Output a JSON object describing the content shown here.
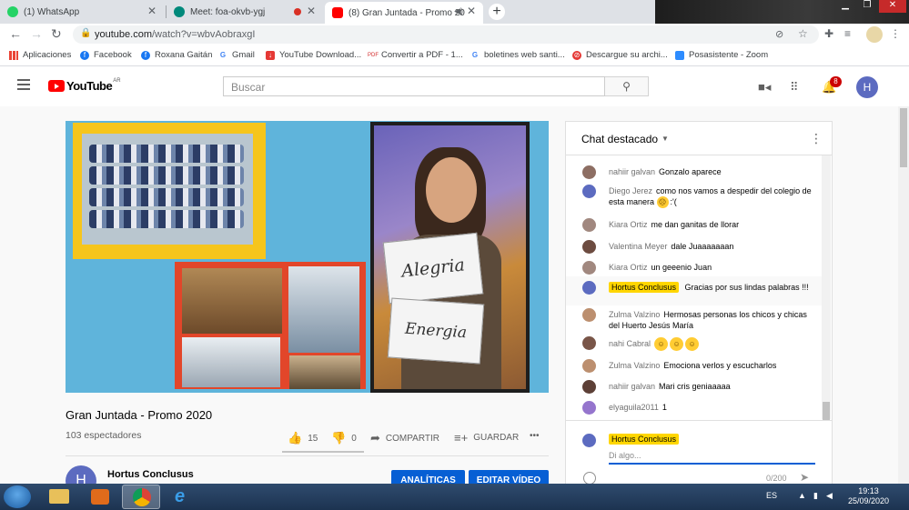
{
  "browser": {
    "tabs": [
      {
        "label": "(1) WhatsApp",
        "icon": "whatsapp-icon",
        "color": "#25d366"
      },
      {
        "label": "Meet: foa-okvb-ygj",
        "icon": "meet-icon",
        "color": "#00897b"
      },
      {
        "label": "(8) Gran Juntada - Promo 20",
        "icon": "youtube-icon",
        "color": "#ff0000"
      }
    ],
    "url_host": "youtube.com",
    "url_path": "/watch?v=wbvAobraxgI",
    "bookmarks": [
      "Aplicaciones",
      "Facebook",
      "Roxana Gaitán",
      "Gmail",
      "YouTube Download...",
      "Convertir a PDF - 1...",
      "boletines web santi...",
      "Descargue su archi...",
      "Posasistente - Zoom"
    ]
  },
  "youtube": {
    "logo_region": "AR",
    "logo_text": "YouTube",
    "search_placeholder": "Buscar",
    "notification_count": "8",
    "user_initial": "H"
  },
  "video": {
    "sign_top": "Alegria",
    "sign_bottom": "Energia",
    "title": "Gran Juntada - Promo 2020",
    "views": "103 espectadores",
    "likes": "15",
    "dislikes": "0",
    "share_label": "COMPARTIR",
    "save_label": "GUARDAR",
    "more_label": "•••"
  },
  "channel": {
    "initial": "H",
    "name": "Hortus Conclusus",
    "analytics_label": "ANALÍTICAS",
    "edit_label": "EDITAR VÍDEO"
  },
  "chat": {
    "title": "Chat destacado",
    "messages": [
      {
        "author": "nahiir galvan",
        "text": "Gonzalo aparece",
        "owner": false
      },
      {
        "author": "Diego Jerez",
        "text": "como nos vamos a despedir del colegio de esta manera",
        "suffix": ":'(",
        "owner": false
      },
      {
        "author": "Kiara Ortiz",
        "text": "me dan ganitas de llorar",
        "owner": false
      },
      {
        "author": "Valentina Meyer",
        "text": "dale Juaaaaaaan",
        "owner": false
      },
      {
        "author": "Kiara Ortiz",
        "text": "un geeenio Juan",
        "owner": false
      },
      {
        "author": "Hortus Conclusus",
        "text": "Gracias por sus lindas palabras !!!",
        "owner": true
      },
      {
        "author": "Zulma Valzino",
        "text": "Hermosas personas los chicos y chicas del Huerto Jesús María",
        "owner": false
      },
      {
        "author": "nahi Cabral",
        "text": "",
        "owner": false
      },
      {
        "author": "Zulma Valzino",
        "text": "Emociona verlos y escucharlos",
        "owner": false
      },
      {
        "author": "nahiir galvan",
        "text": "Mari cris geniaaaaa",
        "owner": false
      },
      {
        "author": "elyaguila2011",
        "text": "1",
        "owner": false
      }
    ],
    "input_author": "Hortus Conclusus",
    "input_placeholder": "Di algo...",
    "char_count": "0/200"
  },
  "taskbar": {
    "language": "ES",
    "time": "19:13",
    "date": "25/09/2020"
  }
}
